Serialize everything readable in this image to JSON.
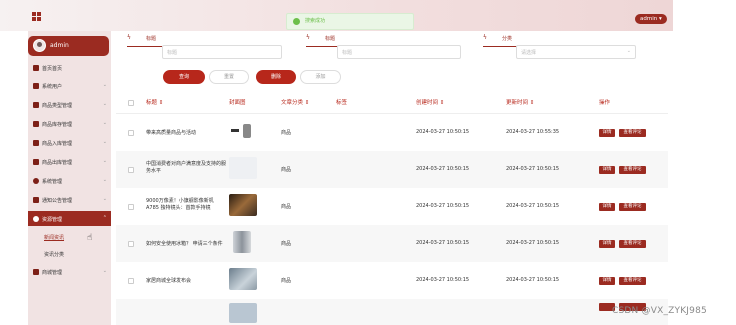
{
  "topbar": {
    "toast": "搜索成功",
    "admin_label": "admin ▾"
  },
  "sidebar": {
    "user": "admin",
    "menu": [
      {
        "label": "首页首页",
        "chev": ""
      },
      {
        "label": "系统用户",
        "chev": "⌄"
      },
      {
        "label": "商品类型管理",
        "chev": "⌄"
      },
      {
        "label": "商品库存管理",
        "chev": "⌄"
      },
      {
        "label": "商品入库管理",
        "chev": "⌄"
      },
      {
        "label": "商品出库管理",
        "chev": "⌄"
      },
      {
        "label": "系统管理",
        "chev": "⌄"
      },
      {
        "label": "通知公告管理",
        "chev": "⌄"
      },
      {
        "label": "资源管理",
        "chev": "⌃"
      }
    ],
    "submenu": [
      "新闻资讯",
      "资讯分类"
    ],
    "last_menu": {
      "label": "商城管理",
      "chev": "⌄"
    }
  },
  "search": {
    "fields": [
      {
        "label": "标题",
        "placeholder": "标题"
      },
      {
        "label": "标题",
        "placeholder": "标题"
      },
      {
        "label": "分类",
        "placeholder": "请选择"
      }
    ],
    "buttons": {
      "query": "查询",
      "reset": "重置",
      "delete": "删除",
      "add": "添加"
    }
  },
  "table": {
    "columns": [
      "标题 ⇕",
      "封面图",
      "文章分类 ⇕",
      "标签",
      "创建时间 ⇕",
      "更新时间 ⇕",
      "操作"
    ],
    "rows": [
      {
        "title": "带来高质量商品与活动",
        "category": "商品",
        "created": "2024-03-27 10:50:15",
        "updated": "2024-03-27 10:55:35"
      },
      {
        "title": "中国消费者对商户满意度及支持的服务水平",
        "category": "商品",
        "created": "2024-03-27 10:50:15",
        "updated": "2024-03-27 10:50:15"
      },
      {
        "title": "9000万像素！小旗舰影像新机A785 独特镜头：首款手持镜",
        "category": "商品",
        "created": "2024-03-27 10:50:15",
        "updated": "2024-03-27 10:50:15"
      },
      {
        "title": "如何安全使用冰箱？ 申请三个条件",
        "category": "商品",
        "created": "2024-03-27 10:50:15",
        "updated": "2024-03-27 10:50:15"
      },
      {
        "title": "家居商城全球发布会",
        "category": "商品",
        "created": "2024-03-27 10:50:15",
        "updated": "2024-03-27 10:50:15"
      }
    ],
    "actions": {
      "detail": "详情",
      "comments": "查看评论"
    }
  },
  "watermark": "CSDN @VX_ZYKJ985",
  "colors": {
    "accent": "#9b2b21",
    "button_red": "#b7271b"
  }
}
